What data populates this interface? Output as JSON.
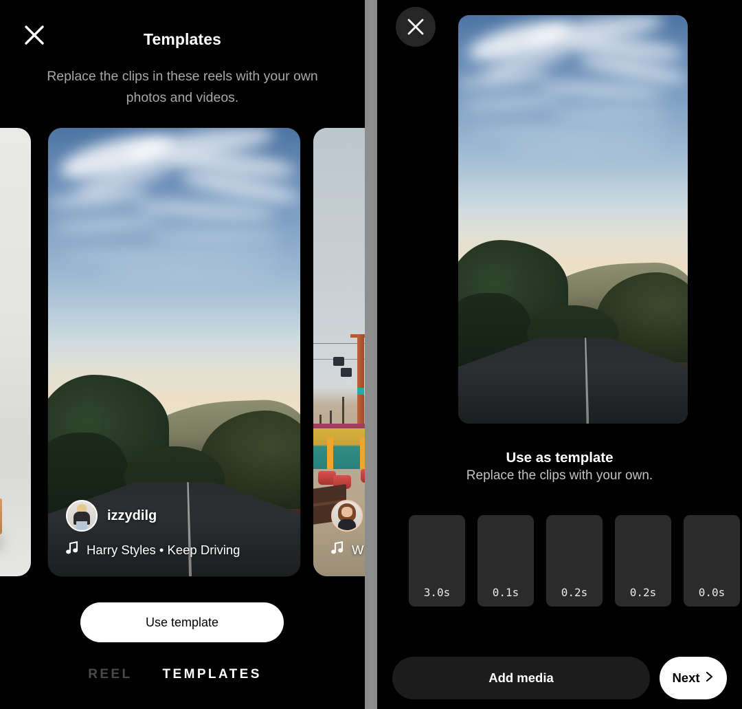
{
  "left_screen": {
    "close_icon": "close-icon",
    "title": "Templates",
    "subtitle": "Replace the clips in these reels with your own photos and videos.",
    "cards": [
      {
        "scene": "interior-chair",
        "username": "",
        "audio": ""
      },
      {
        "scene": "coastal-road",
        "username": "izzydilg",
        "audio": "Harry Styles • Keep Driving",
        "music_icon": "music-note-icon"
      },
      {
        "scene": "beach-pier",
        "username": "",
        "audio": "W",
        "music_icon": "music-note-icon"
      }
    ],
    "use_template_label": "Use template",
    "tabs": [
      {
        "label": "REEL",
        "active": false
      },
      {
        "label": "TEMPLATES",
        "active": true
      }
    ]
  },
  "right_screen": {
    "close_icon": "close-icon",
    "preview_scene": "coastal-road",
    "title": "Use as template",
    "subtitle": "Replace the clips with your own.",
    "clips": [
      {
        "duration": "3.0s"
      },
      {
        "duration": "0.1s"
      },
      {
        "duration": "0.2s"
      },
      {
        "duration": "0.2s"
      },
      {
        "duration": "0.0s"
      }
    ],
    "add_media_label": "Add media",
    "next_label": "Next",
    "next_icon": "chevron-right-icon"
  },
  "colors": {
    "background": "#000000",
    "divider": "#8d8d8d",
    "accent_white": "#ffffff",
    "muted_text": "#a8a8a8",
    "clip_box": "#2b2b2b",
    "add_media_bg": "#1c1c1c",
    "tab_inactive": "#4a4a4a"
  }
}
